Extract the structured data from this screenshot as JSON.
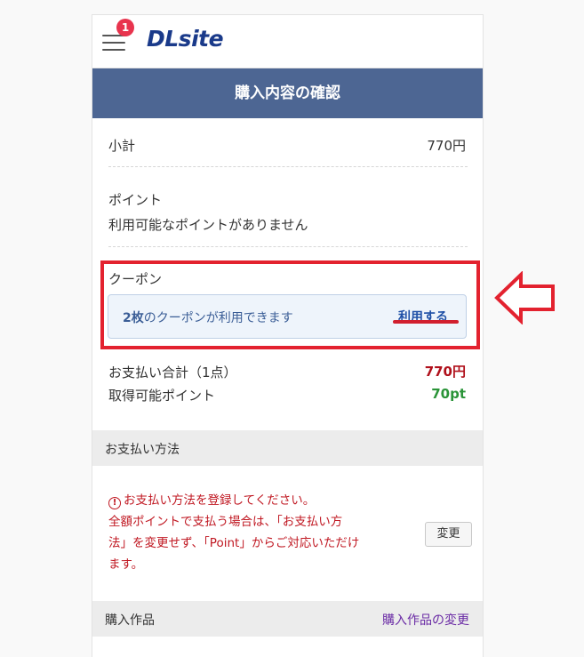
{
  "header": {
    "logo": "DLsite",
    "notification_count": "1"
  },
  "page_title": "購入内容の確認",
  "subtotal": {
    "label": "小計",
    "value": "770円"
  },
  "points": {
    "label": "ポイント",
    "message": "利用可能なポイントがありません"
  },
  "coupon": {
    "label": "クーポン",
    "count_text": "2枚",
    "available_text": "のクーポンが利用できます",
    "use_link": "利用する"
  },
  "total": {
    "label": "お支払い合計（1点）",
    "value": "770円",
    "points_label": "取得可能ポイント",
    "points_value": "70pt"
  },
  "payment_method": {
    "heading": "お支払い方法",
    "warning_line1": "お支払い方法を登録してください。",
    "warning_line2": "全額ポイントで支払う場合は、「お支払い方",
    "warning_line3": "法」を変更せず、「Point」からご対応いただけ",
    "warning_line4": "ます。",
    "change_button": "変更"
  },
  "purchased_items": {
    "heading": "購入作品",
    "change_link": "購入作品の変更"
  },
  "colors": {
    "title_bar": "#4d6693",
    "highlight": "#e3222f",
    "price": "#b0101b",
    "points": "#2a9438",
    "warning": "#c01822",
    "link": "#6a2ba5"
  }
}
